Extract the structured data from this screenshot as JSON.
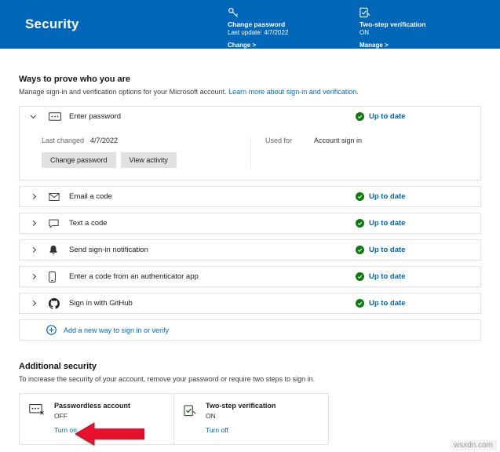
{
  "header": {
    "title": "Security",
    "cards": [
      {
        "icon": "key-icon",
        "title": "Change password",
        "subtitle": "Last update: 4/7/2022",
        "link": "Change >"
      },
      {
        "icon": "shield-check-icon",
        "title": "Two-step verification",
        "subtitle": "ON",
        "link": "Manage >"
      }
    ]
  },
  "ways": {
    "heading": "Ways to prove who you are",
    "description": "Manage sign-in and verification options for your Microsoft account. ",
    "learn_more": "Learn more about sign-in and verification.",
    "rows": [
      {
        "icon": "password-icon",
        "label": "Enter password",
        "status": "Up to date"
      },
      {
        "icon": "email-icon",
        "label": "Email a code",
        "status": "Up to date"
      },
      {
        "icon": "message-icon",
        "label": "Text a code",
        "status": "Up to date"
      },
      {
        "icon": "bell-icon",
        "label": "Send sign-in notification",
        "status": "Up to date"
      },
      {
        "icon": "phone-icon",
        "label": "Enter a code from an authenticator app",
        "status": "Up to date"
      },
      {
        "icon": "github-icon",
        "label": "Sign in with GitHub",
        "status": "Up to date"
      }
    ],
    "password_details": {
      "last_changed_label": "Last changed",
      "last_changed_value": "4/7/2022",
      "buttons": [
        "Change password",
        "View activity"
      ],
      "used_for_label": "Used for",
      "used_for_value": "Account sign in"
    },
    "add_label": "Add a new way to sign in or verify"
  },
  "additional": {
    "heading": "Additional security",
    "description": "To increase the security of your account, remove your password or require two steps to sign in.",
    "cards": [
      {
        "icon": "passwordless-icon",
        "title": "Passwordless account",
        "state": "OFF",
        "action": "Turn on"
      },
      {
        "icon": "two-step-icon",
        "title": "Two-step verification",
        "state": "ON",
        "action": "Turn off"
      }
    ]
  },
  "colors": {
    "header_blue": "#0067b8",
    "link_blue": "#0067b8",
    "status_green": "#0f7b0f",
    "arrow_red": "#e8112d"
  },
  "watermark": "wsxdn.com"
}
